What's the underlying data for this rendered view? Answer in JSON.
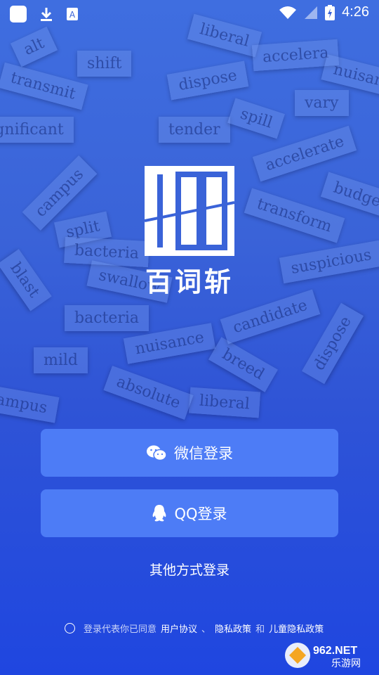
{
  "status_bar": {
    "time": "4:26"
  },
  "background_words": [
    "alt",
    "shift",
    "liberal",
    "accelera",
    "transmit",
    "dispose",
    "nuisance",
    "vary",
    "significant",
    "tender",
    "spill",
    "accelerate",
    "budget",
    "campus",
    "split",
    "transform",
    "bacteria",
    "swallow",
    "suspicious",
    "blast",
    "bacteria",
    "nuisance",
    "breed",
    "liberal",
    "absolute",
    "mild",
    "ampus",
    "dispose",
    "candidate"
  ],
  "app": {
    "name": "百词斩"
  },
  "buttons": {
    "wechat": "微信登录",
    "qq": "QQ登录",
    "other": "其他方式登录"
  },
  "agreement": {
    "prefix": "登录代表你已同意",
    "user_agreement": "用户协议",
    "separator": "、",
    "privacy": "隐私政策",
    "and": "和",
    "child_privacy": "儿童隐私政策"
  },
  "watermark": {
    "top": "962.NET",
    "bottom": "乐游网"
  }
}
